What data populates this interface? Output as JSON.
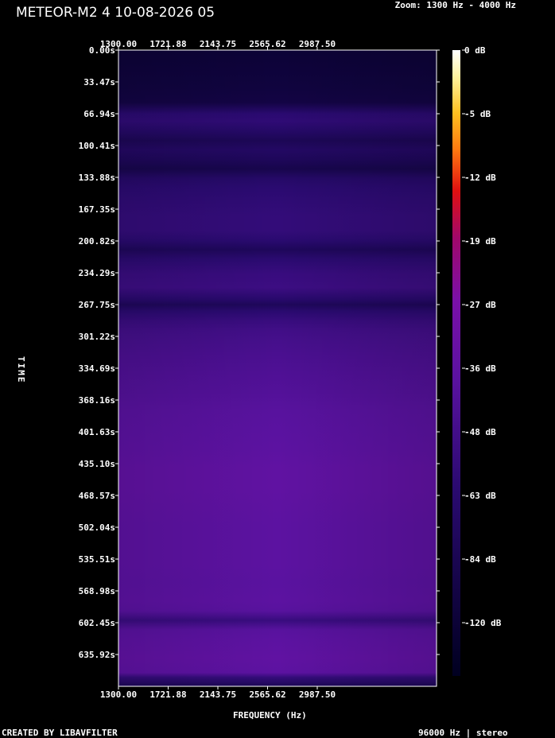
{
  "header": {
    "title": "METEOR-M2 4 10-08-2026 05",
    "zoom": "Zoom: 1300 Hz - 4000 Hz"
  },
  "footer": {
    "created_by": "CREATED BY LIBAVFILTER",
    "sample_info": "96000 Hz | stereo"
  },
  "chart_data": {
    "type": "heatmap",
    "title": "",
    "xlabel": "FREQUENCY (Hz)",
    "ylabel": "TIME",
    "x_ticks": [
      "1300.00",
      "1721.88",
      "2143.75",
      "2565.62",
      "2987.50"
    ],
    "x_tick_values": [
      1300.0,
      1721.88,
      2143.75,
      2565.62,
      2987.5
    ],
    "x_range": [
      1300,
      4000
    ],
    "y_ticks": [
      "0.00s",
      "33.47s",
      "66.94s",
      "100.41s",
      "133.88s",
      "167.35s",
      "200.82s",
      "234.29s",
      "267.75s",
      "301.22s",
      "334.69s",
      "368.16s",
      "401.63s",
      "435.10s",
      "468.57s",
      "502.04s",
      "535.51s",
      "568.98s",
      "602.45s",
      "635.92s"
    ],
    "y_tick_values": [
      0.0,
      33.47,
      66.94,
      100.41,
      133.88,
      167.35,
      200.82,
      234.29,
      267.75,
      301.22,
      334.69,
      368.16,
      401.63,
      435.1,
      468.57,
      502.04,
      535.51,
      568.98,
      602.45,
      635.92
    ],
    "y_range": [
      0,
      669.4
    ],
    "colorbar": {
      "labels": [
        "0 dB",
        "-5 dB",
        "-12 dB",
        "-19 dB",
        "-27 dB",
        "-36 dB",
        "-48 dB",
        "-63 dB",
        "-84 dB",
        "-120 dB"
      ],
      "values": [
        0,
        -5,
        -12,
        -19,
        -27,
        -36,
        -48,
        -63,
        -84,
        -120
      ],
      "colors": [
        "#ffffff",
        "#fff3a0",
        "#ffc020",
        "#ff7a10",
        "#e01010",
        "#a0086a",
        "#7a10a8",
        "#5a12a0",
        "#2a0a70",
        "#000020"
      ]
    },
    "intensity_profile": {
      "time_s": [
        0,
        20,
        40,
        55,
        67,
        75,
        85,
        95,
        105,
        115,
        125,
        135,
        145,
        160,
        175,
        190,
        200,
        210,
        220,
        235,
        250,
        262,
        268,
        275,
        285,
        295,
        305,
        320,
        340,
        360,
        380,
        400,
        420,
        440,
        460,
        480,
        500,
        520,
        540,
        560,
        580,
        590,
        600,
        610,
        620,
        640,
        655,
        660,
        669.4
      ],
      "level_db": [
        -110,
        -108,
        -106,
        -104,
        -84,
        -82,
        -88,
        -96,
        -90,
        -94,
        -100,
        -88,
        -84,
        -82,
        -80,
        -80,
        -84,
        -94,
        -84,
        -78,
        -76,
        -86,
        -94,
        -84,
        -78,
        -74,
        -72,
        -70,
        -68,
        -66,
        -64,
        -63,
        -62,
        -60,
        -60,
        -61,
        -62,
        -62,
        -62,
        -63,
        -62,
        -64,
        -78,
        -64,
        -62,
        -60,
        -62,
        -80,
        -96
      ]
    },
    "grid": false
  }
}
